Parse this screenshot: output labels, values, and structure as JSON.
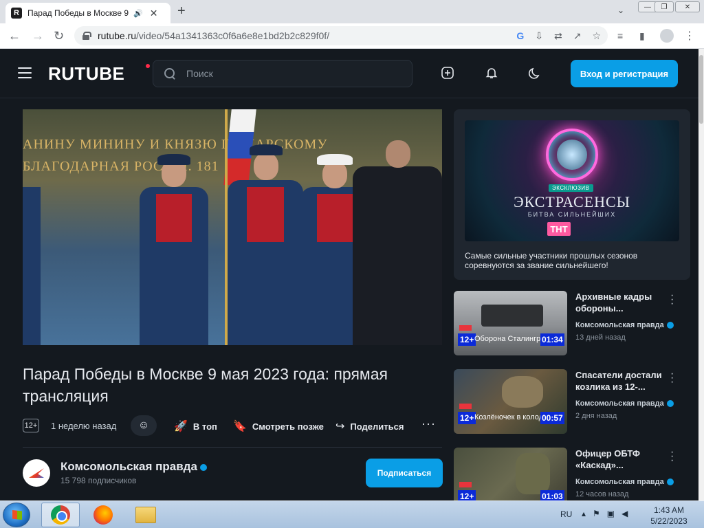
{
  "browser": {
    "tab_title": "Парад Победы в Москве 9",
    "tab_favicon": "R",
    "url_host": "rutube.ru",
    "url_path": "/video/54a1341363c0f6a6e8e1bd2b2c829f0f/"
  },
  "header": {
    "logo": "RUTUBE",
    "search_placeholder": "Поиск",
    "login_label": "Вход и регистрация"
  },
  "video": {
    "title": "Парад Победы в Москве 9 мая 2023 года: прямая трансляция",
    "age": "12+",
    "published": "1 неделю назад",
    "actions": {
      "top": "В топ",
      "watch_later": "Смотреть позже",
      "share": "Поделиться"
    },
    "frame_text_line1": "АНИНУ МИНИНУ И КНЯЗЮ ПОЖАРСКОМУ",
    "frame_text_line2": "БЛАГОДАРНАЯ РОССІЯ. 181"
  },
  "channel": {
    "name": "Комсомольская правда",
    "subscribers": "15 798 подписчиков",
    "subscribe_label": "Подписаться"
  },
  "ad": {
    "badge": "ЭКСКЛЮЗИВ",
    "image_title": "ЭКСТРАСЕНСЫ",
    "image_subtitle": "БИТВА СИЛЬНЕЙШИХ",
    "network": "ТНТ",
    "text": "Самые сильные участники прошлых сезонов соревнуются за звание сильнейшего!"
  },
  "recommendations": [
    {
      "title": "Архивные кадры обороны...",
      "channel": "Комсомольская правда",
      "time": "13 дней назад",
      "age": "12+",
      "caption": "Оборона Сталинград",
      "duration": "01:34"
    },
    {
      "title": "Спасатели достали козлика из 12-...",
      "channel": "Комсомольская правда",
      "time": "2 дня назад",
      "age": "12+",
      "caption": "Козлёночек в колодц",
      "duration": "00:57"
    },
    {
      "title": "Офицер ОБТФ «Каскад»...",
      "channel": "Комсомольская правда",
      "time": "12 часов назад",
      "age": "12+",
      "caption": "",
      "duration": "01:03"
    }
  ],
  "taskbar": {
    "lang": "RU",
    "time": "1:43 AM",
    "date": "5/22/2023"
  },
  "colors": {
    "page_bg": "#14191f",
    "accent": "#0a9ee6",
    "logo_dot": "#ff2a4a"
  }
}
